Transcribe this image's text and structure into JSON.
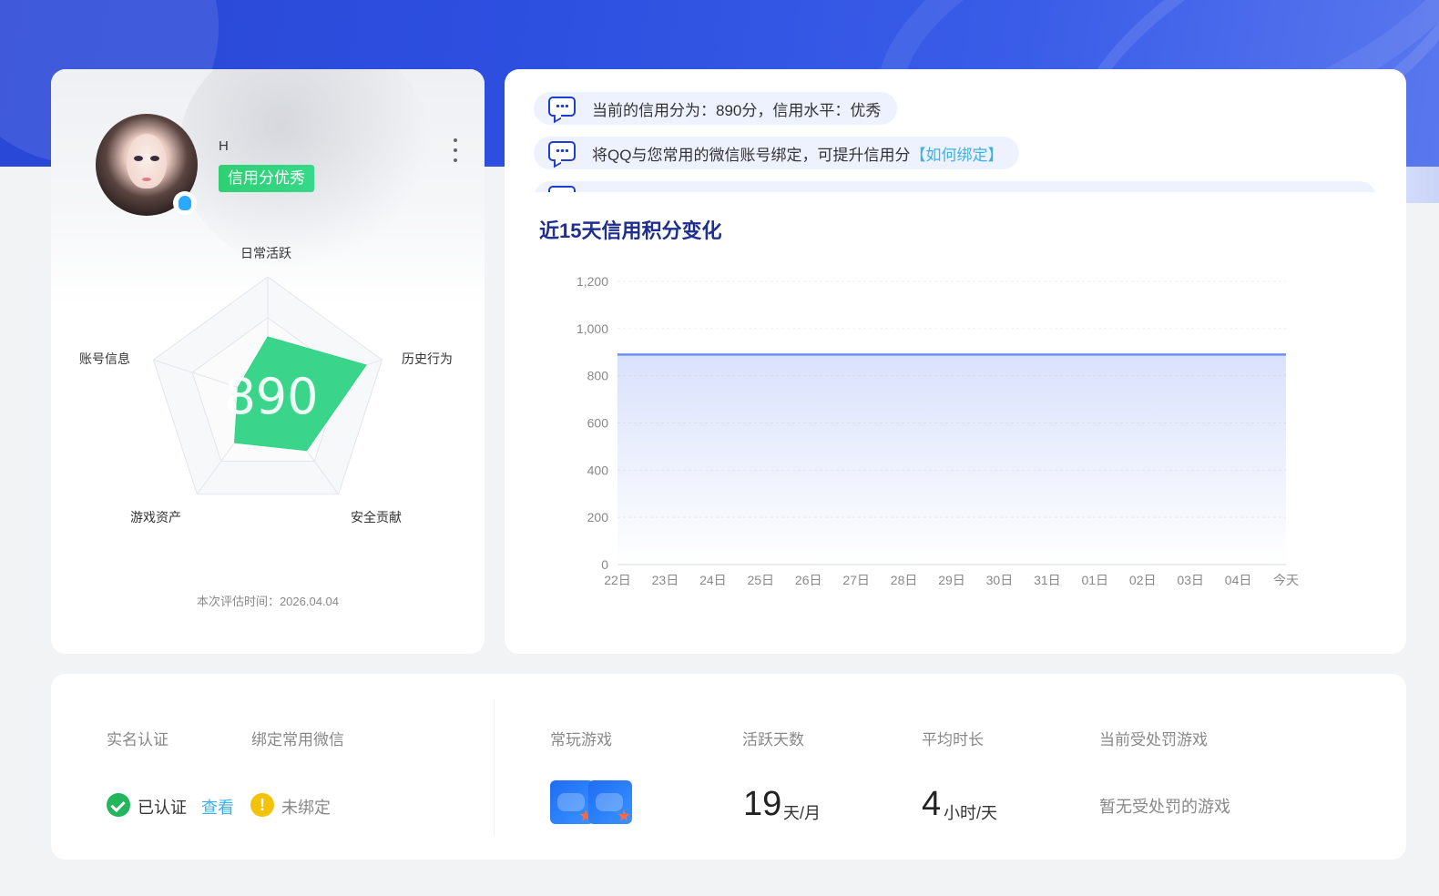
{
  "profile": {
    "name": "H",
    "credit_tag": "信用分优秀",
    "radar": {
      "axes": [
        "日常活跃",
        "历史行为",
        "安全贡献",
        "游戏资产",
        "账号信息"
      ],
      "values": [
        0.5,
        0.86,
        0.55,
        0.47,
        0.26
      ],
      "center_score": "890"
    },
    "eval_time": "本次评估时间：2026.04.04"
  },
  "notices": [
    {
      "text": "当前的信用分为：890分，信用水平：优秀",
      "link": ""
    },
    {
      "text": "将QQ与您常用的微信账号绑定，可提升信用分",
      "link": "【如何绑定】"
    }
  ],
  "chart_title": "近15天信用积分变化",
  "chart_data": {
    "type": "area",
    "categories": [
      "22日",
      "23日",
      "24日",
      "25日",
      "26日",
      "27日",
      "28日",
      "29日",
      "30日",
      "31日",
      "01日",
      "02日",
      "03日",
      "04日",
      "今天"
    ],
    "values": [
      890,
      890,
      890,
      890,
      890,
      890,
      890,
      890,
      890,
      890,
      890,
      890,
      890,
      890,
      890
    ],
    "ylim": [
      0,
      1200
    ],
    "yticks": [
      0,
      200,
      400,
      600,
      800,
      1000,
      1200
    ],
    "ytick_labels": [
      "0",
      "200",
      "400",
      "600",
      "800",
      "1,000",
      "1,200"
    ],
    "grid": true,
    "color": "#6f8ff0"
  },
  "stats": {
    "real_name": {
      "label": "实名认证",
      "status": "已认证",
      "link": "查看"
    },
    "wechat": {
      "label": "绑定常用微信",
      "status": "未绑定"
    },
    "games": {
      "label": "常玩游戏"
    },
    "active_days": {
      "label": "活跃天数",
      "value": "19",
      "unit": "天/月"
    },
    "avg_duration": {
      "label": "平均时长",
      "value": "4",
      "unit": "小时/天"
    },
    "penalty": {
      "label": "当前受处罚游戏",
      "value": "暂无受处罚的游戏"
    }
  },
  "colors": {
    "accent": "#2d4fe0",
    "success": "#22b55c",
    "warning": "#f5c20a",
    "link": "#3bb1e6",
    "radar_fill": "#2fd385"
  }
}
